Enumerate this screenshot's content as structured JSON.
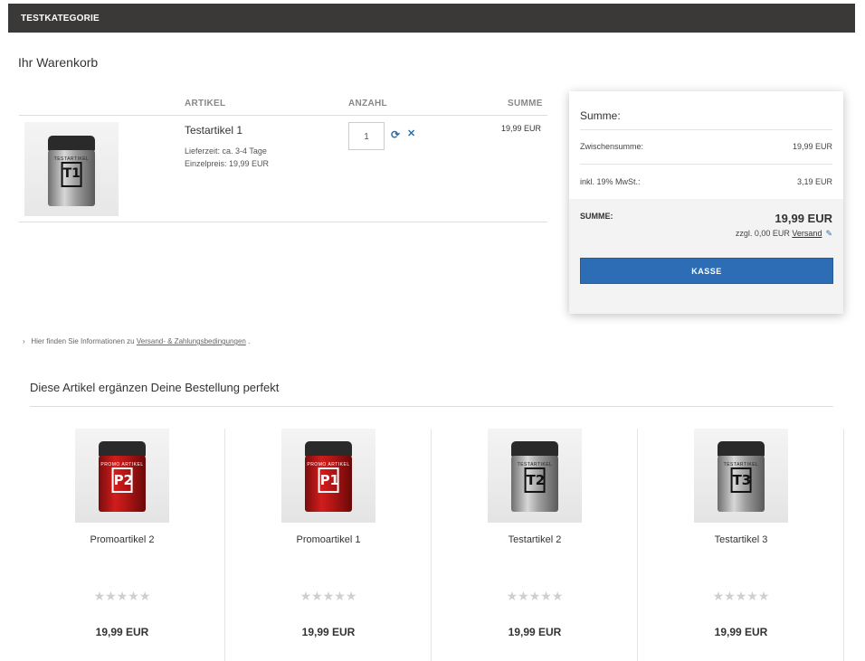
{
  "topbar": {
    "category": "TESTKATEGORIE"
  },
  "cart": {
    "title": "Ihr Warenkorb",
    "columns": {
      "article": "ARTIKEL",
      "quantity": "ANZAHL",
      "sum": "SUMME"
    },
    "items": [
      {
        "name": "Testartikel 1",
        "image_label": "T1",
        "image_top_text": "TESTARTIKEL",
        "delivery": "Lieferzeit: ca. 3-4 Tage",
        "unit_price": "Einzelpreis: 19,99 EUR",
        "quantity": "1",
        "sum": "19,99 EUR"
      }
    ]
  },
  "summary": {
    "title": "Summe:",
    "subtotal_label": "Zwischensumme:",
    "subtotal_value": "19,99 EUR",
    "vat_label": "inkl. 19% MwSt.:",
    "vat_value": "3,19 EUR",
    "total_label": "SUMME:",
    "total_value": "19,99 EUR",
    "shipping_prefix": "zzgl. 0,00 EUR",
    "shipping_link": "Versand",
    "checkout_label": "KASSE"
  },
  "info": {
    "prefix": "Hier finden Sie Informationen zu",
    "link": "Versand- & Zahlungsbedingungen",
    "suffix": "."
  },
  "recommendations": {
    "title": "Diese Artikel ergänzen Deine Bestellung perfekt",
    "products": [
      {
        "name": "Promoartikel 2",
        "label": "P2",
        "top_text": "PROMO ARTIKEL",
        "color": "red",
        "rating": "★★★★★",
        "price": "19,99 EUR"
      },
      {
        "name": "Promoartikel 1",
        "label": "P1",
        "top_text": "PROMO ARTIKEL",
        "color": "red",
        "rating": "★★★★★",
        "price": "19,99 EUR"
      },
      {
        "name": "Testartikel 2",
        "label": "T2",
        "top_text": "TESTARTIKEL",
        "color": "silver",
        "rating": "★★★★★",
        "price": "19,99 EUR"
      },
      {
        "name": "Testartikel 3",
        "label": "T3",
        "top_text": "TESTARTIKEL",
        "color": "silver",
        "rating": "★★★★★",
        "price": "19,99 EUR"
      }
    ]
  },
  "colors": {
    "accent": "#2d6db5",
    "topbar": "#3b3838"
  }
}
